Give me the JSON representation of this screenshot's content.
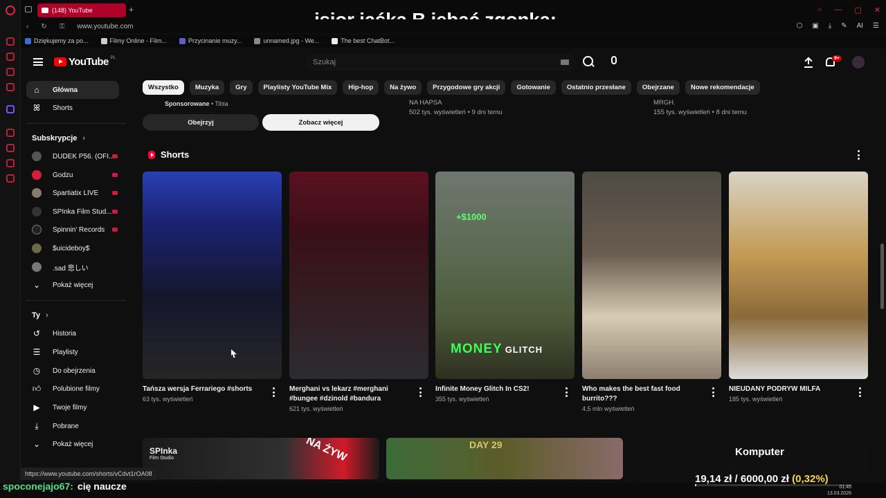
{
  "browser": {
    "tab_title": "(148) YouTube",
    "url": "www.youtube.com",
    "ai_label": "AI",
    "bookmarks": [
      "Dziękujemy za po...",
      "Filmy Online - Film...",
      "Przycinanie muzy...",
      "unnamed.jpg - We...",
      "The best ChatBot..."
    ]
  },
  "overlay_title": "isior jaśka B jebać zgonka:",
  "header": {
    "logo_text": "YouTube",
    "region": "PL",
    "search_placeholder": "Szukaj",
    "notifications_badge": "9+"
  },
  "sidebar": {
    "main": [
      {
        "label": "Główna",
        "icon": "home-icon",
        "active": true
      },
      {
        "label": "Shorts",
        "icon": "shorts-icon",
        "active": false
      }
    ],
    "subs_title": "Subskrypcje",
    "subscriptions": [
      {
        "label": "DUDEK P56. (OFI...",
        "avatar_color": "#555555"
      },
      {
        "label": "Godzu",
        "avatar_color": "#d0203a"
      },
      {
        "label": "Spartiatix LIVE",
        "avatar_color": "#8a7a6a"
      },
      {
        "label": "SPInka Film Stud...",
        "avatar_color": "#333333"
      },
      {
        "label": "Spinnin' Records",
        "avatar_color": "#222222"
      },
      {
        "label": "$uicideboy$",
        "avatar_color": "#6a6a4a"
      },
      {
        "label": ".sad 悲しい",
        "avatar_color": "#777777"
      }
    ],
    "subs_more": "Pokaż więcej",
    "you_title": "Ty",
    "you_items": [
      {
        "label": "Historia",
        "icon": "history-icon"
      },
      {
        "label": "Playlisty",
        "icon": "playlist-icon"
      },
      {
        "label": "Do obejrzenia",
        "icon": "clock-icon"
      },
      {
        "label": "Polubione filmy",
        "icon": "thumbs-up-icon"
      },
      {
        "label": "Twoje filmy",
        "icon": "video-icon"
      },
      {
        "label": "Pobrane",
        "icon": "download-icon"
      },
      {
        "label": "Pokaż więcej",
        "icon": "chevron-down-icon"
      }
    ]
  },
  "chips": [
    "Wszystko",
    "Muzyka",
    "Gry",
    "Playlisty YouTube Mix",
    "Hip-hop",
    "Na żywo",
    "Przygodowe gry akcji",
    "Gotowanie",
    "Ostatnio przesłane",
    "Obejrzane",
    "Nowe rekomendacje"
  ],
  "sponsored": {
    "label": "Sponsorowane",
    "advertiser": "Tibia",
    "watch_btn": "Obejrzyj",
    "more_btn": "Zobacz więcej"
  },
  "top_meta": [
    {
      "channel": "NA HAPSA",
      "stats": "502 tys. wyświetleń • 9 dni temu"
    },
    {
      "channel": "MRGH.",
      "stats": "155 tys. wyświetleń • 8 dni temu"
    }
  ],
  "shorts_section": {
    "title": "Shorts",
    "items": [
      {
        "title": "Tańsza wersja Ferrariego #shorts",
        "views": "63 tys. wyświetleń"
      },
      {
        "title": "Merghani vs lekarz #merghani #bungee #dzinold #bandura",
        "views": "621 tys. wyświetleń"
      },
      {
        "title": "Infinite Money Glitch In CS2!",
        "views": "355 tys. wyświetleń",
        "overlay_main": "MONEY",
        "overlay_sub": "GLITCH",
        "overlay_price": "+$1000"
      },
      {
        "title": "Who makes the best fast food burrito???",
        "views": "4,5 mln wyświetleń"
      },
      {
        "title": "NIEUDANY PODRYW MILFA",
        "views": "185 tys. wyświetleń"
      }
    ]
  },
  "row2": {
    "brand": "SPInka",
    "brand_sub": "Film Studio",
    "live_text": "NA ŻYW",
    "day_text": "DAY 29",
    "komputer": "Komputer"
  },
  "status_url": "https://www.youtube.com/shorts/vCdvt1rOA08",
  "chat": {
    "user": "spoconejajo67:",
    "message": "cię naucze"
  },
  "donation": {
    "current": "19,14 zł",
    "goal": "6000,00 zł",
    "percent": "(0,32%)",
    "fraction": 0.0032
  },
  "clock": {
    "time": "01:45",
    "date": "13.03.2026"
  }
}
